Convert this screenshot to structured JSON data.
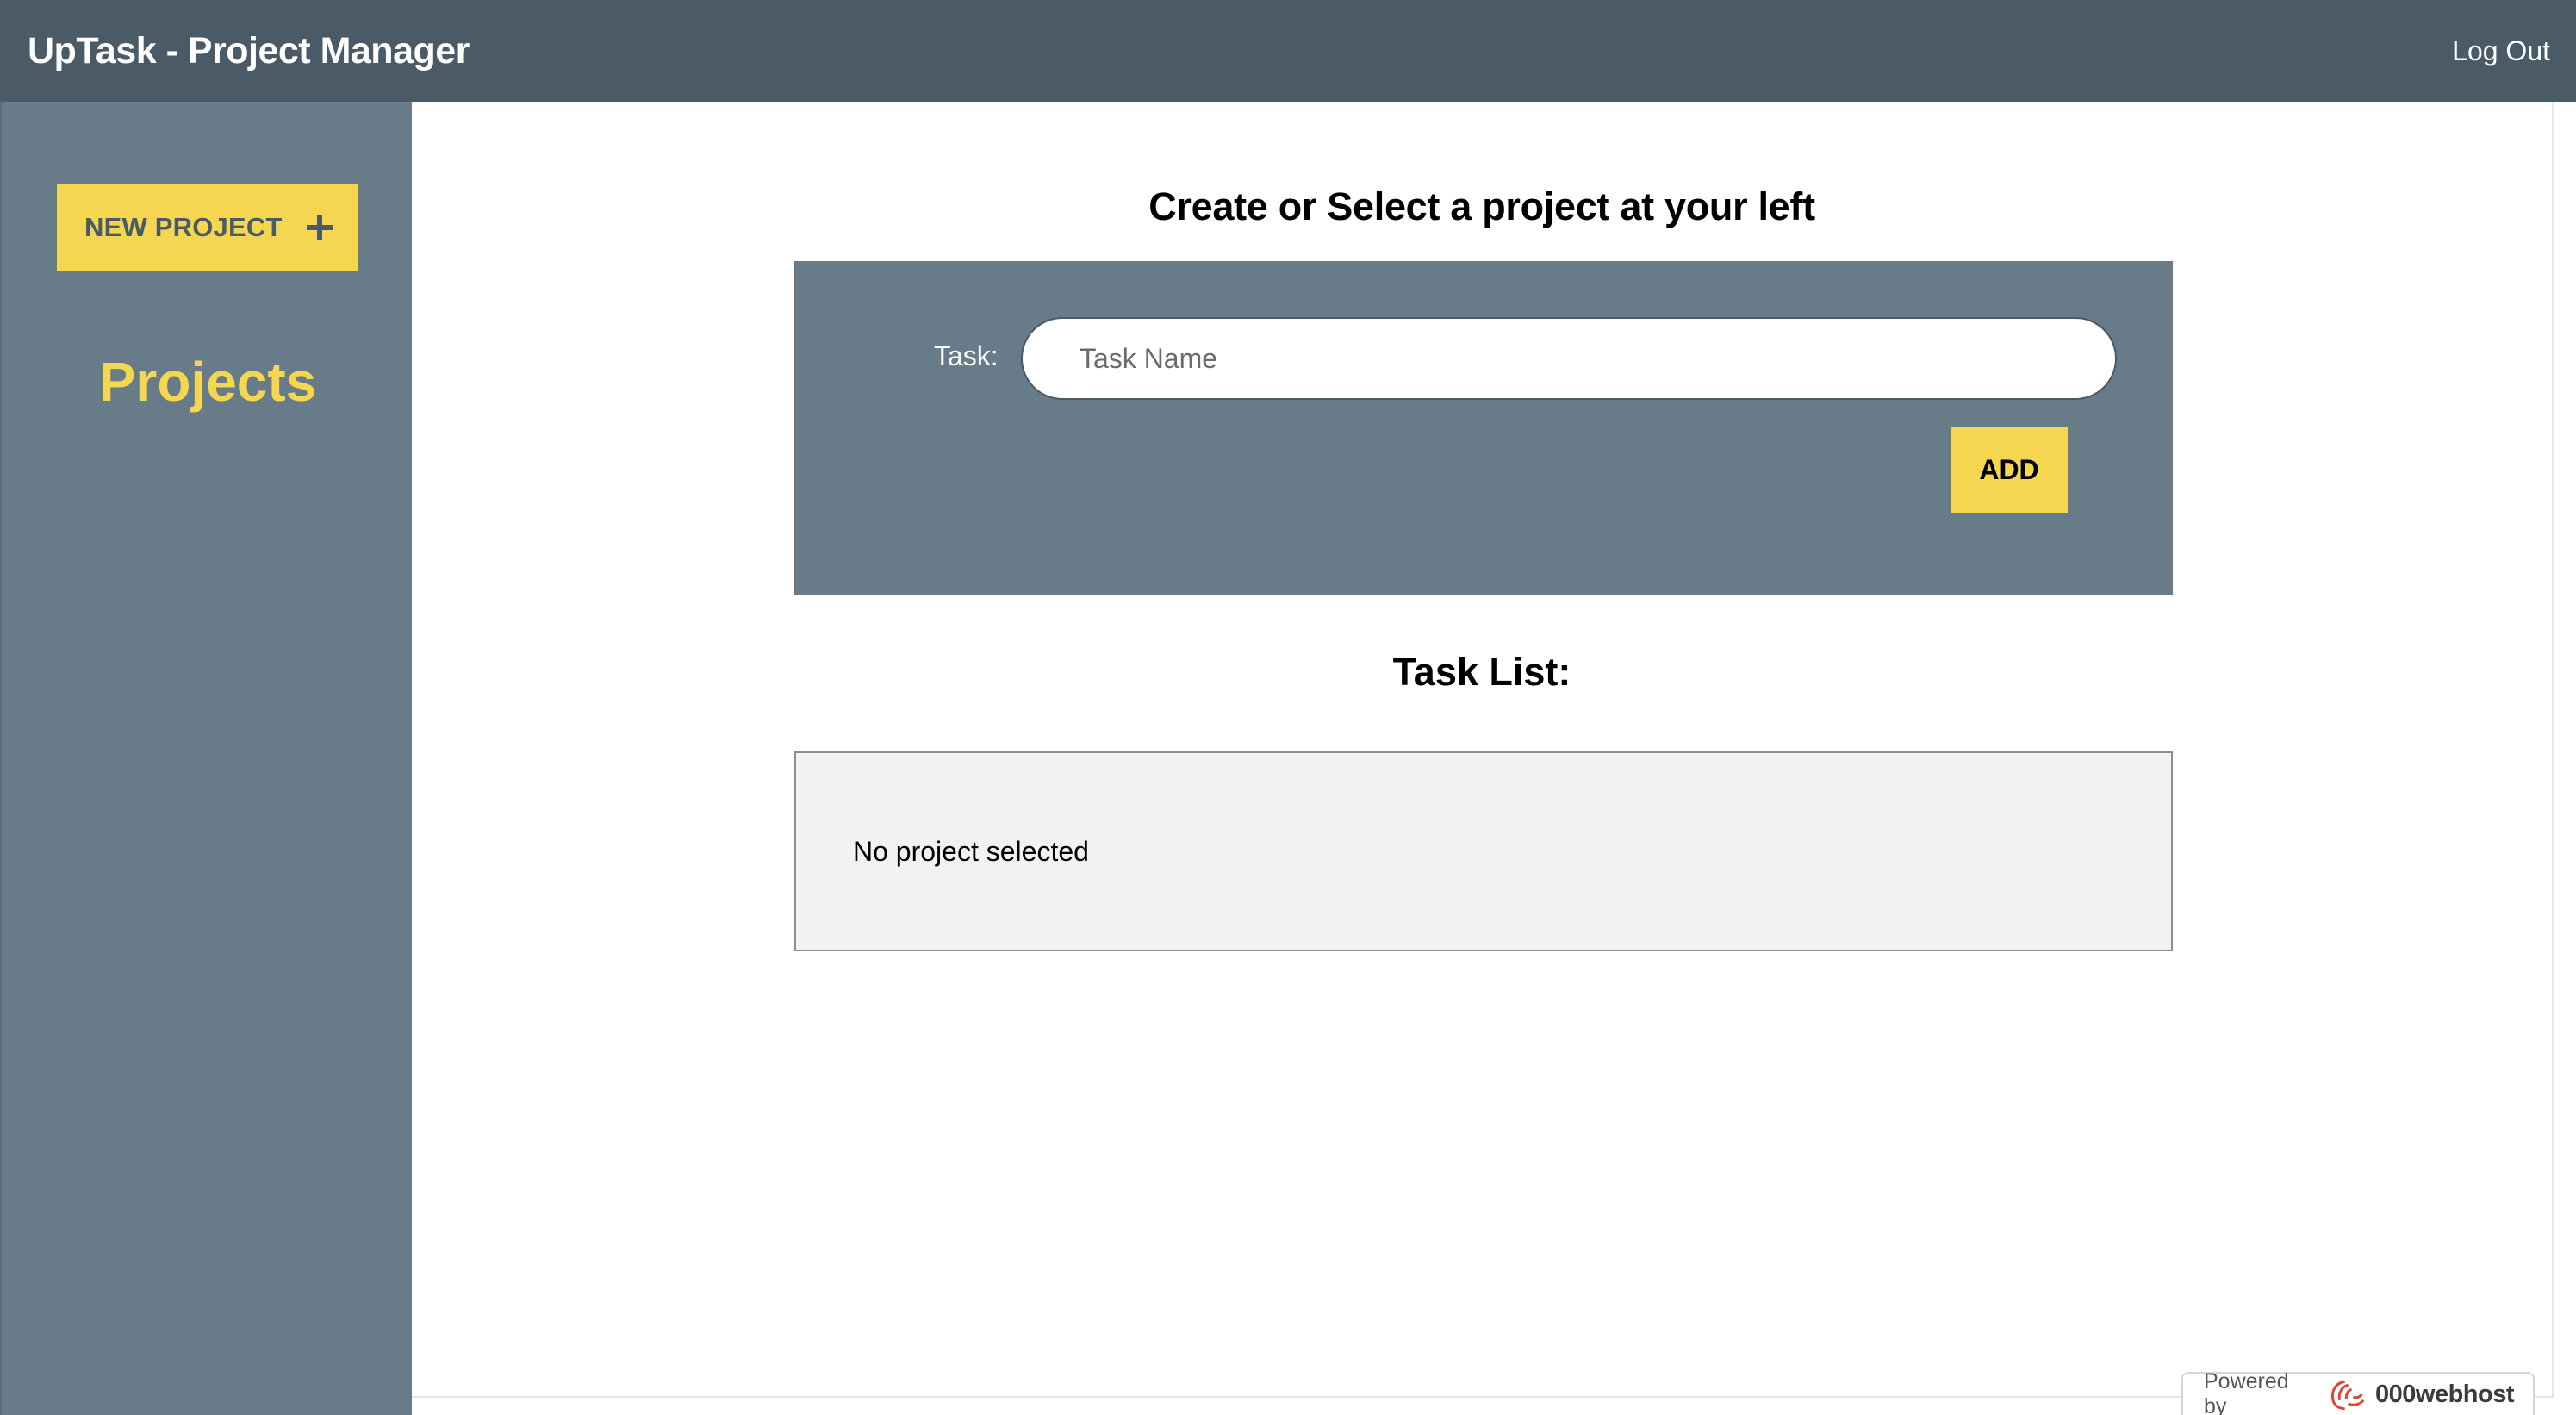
{
  "header": {
    "title": "UpTask - Project Manager",
    "logout_label": "Log Out"
  },
  "sidebar": {
    "new_project_label": "NEW PROJECT",
    "projects_heading": "Projects"
  },
  "main": {
    "heading": "Create or Select a project at your left",
    "task_form": {
      "label": "Task:",
      "input_value": "",
      "input_placeholder": "Task Name",
      "add_label": "ADD"
    },
    "task_list": {
      "heading": "Task List:",
      "empty_message": "No project selected"
    }
  },
  "footer_badge": {
    "powered_by": "Powered by",
    "host_name": "000webhost"
  },
  "colors": {
    "header_bg": "#4a5a66",
    "sidebar_bg": "#677b88",
    "accent_yellow": "#f5d651",
    "panel_bg": "#677b88",
    "list_bg": "#f2f2f2"
  },
  "icons": {
    "new_project": "plus-icon",
    "host_logo": "000webhost-logo-icon"
  }
}
